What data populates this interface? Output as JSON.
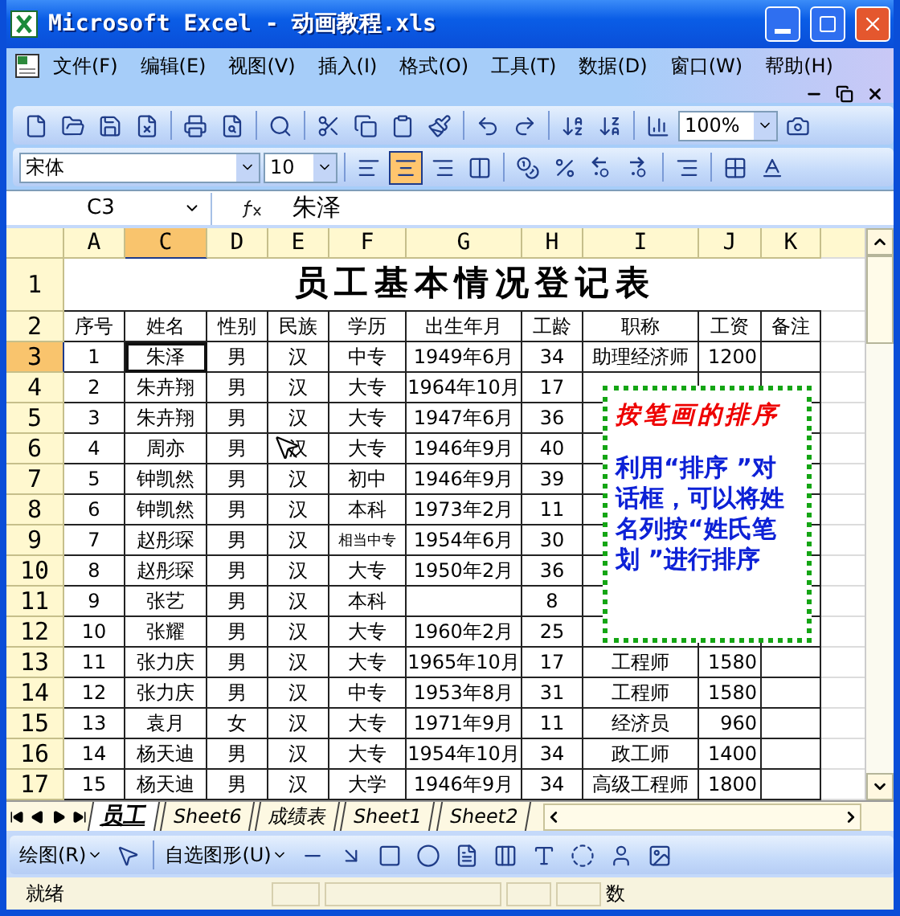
{
  "window": {
    "title": "Microsoft Excel - 动画教程.xls"
  },
  "menu": [
    {
      "label": "文件(F)"
    },
    {
      "label": "编辑(E)"
    },
    {
      "label": "视图(V)"
    },
    {
      "label": "插入(I)"
    },
    {
      "label": "格式(O)"
    },
    {
      "label": "工具(T)"
    },
    {
      "label": "数据(D)"
    },
    {
      "label": "窗口(W)"
    },
    {
      "label": "帮助(H)"
    }
  ],
  "standard_toolbar": {
    "zoom": "100%"
  },
  "formatting_toolbar": {
    "font": "宋体",
    "size": "10",
    "align": [
      {
        "selected": false
      },
      {
        "selected": true
      },
      {
        "selected": false
      }
    ]
  },
  "formula_bar": {
    "name_box": "C3",
    "value": "朱泽"
  },
  "sheet": {
    "columns": [
      {
        "label": "A",
        "selected": false
      },
      {
        "label": "C",
        "selected": true
      },
      {
        "label": "D",
        "selected": false
      },
      {
        "label": "E",
        "selected": false
      },
      {
        "label": "F",
        "selected": false
      },
      {
        "label": "G",
        "selected": false
      },
      {
        "label": "H",
        "selected": false
      },
      {
        "label": "I",
        "selected": false
      },
      {
        "label": "J",
        "selected": false
      },
      {
        "label": "K",
        "selected": false
      }
    ],
    "title_row": {
      "number": "1",
      "title": "员工基本情况登记表"
    },
    "header_row": {
      "number": "2",
      "cells": {
        "A": "序号",
        "C": "姓名",
        "D": "性别",
        "E": "民族",
        "F": "学历",
        "G": "出生年月",
        "H": "工龄",
        "I": "职称",
        "J": "工资",
        "K": "备注"
      }
    },
    "rows": [
      {
        "number": "3",
        "selected": true,
        "cells": {
          "A": "1",
          "C": "朱泽",
          "D": "男",
          "E": "汉",
          "F": "中专",
          "G": "1949年6月",
          "H": "34",
          "I": "助理经济师",
          "J": "1200"
        }
      },
      {
        "number": "4",
        "selected": false,
        "cells": {
          "A": "2",
          "C": "朱卉翔",
          "D": "男",
          "E": "汉",
          "F": "大专",
          "G": "1964年10月",
          "H": "17"
        }
      },
      {
        "number": "5",
        "selected": false,
        "cells": {
          "A": "3",
          "C": "朱卉翔",
          "D": "男",
          "E": "汉",
          "F": "大专",
          "G": "1947年6月",
          "H": "36"
        }
      },
      {
        "number": "6",
        "selected": false,
        "cells": {
          "A": "4",
          "C": "周亦",
          "D": "男",
          "E": "汉",
          "F": "大专",
          "G": "1946年9月",
          "H": "40"
        }
      },
      {
        "number": "7",
        "selected": false,
        "cells": {
          "A": "5",
          "C": "钟凯然",
          "D": "男",
          "E": "汉",
          "F": "初中",
          "G": "1946年9月",
          "H": "39"
        }
      },
      {
        "number": "8",
        "selected": false,
        "cells": {
          "A": "6",
          "C": "钟凯然",
          "D": "男",
          "E": "汉",
          "F": "本科",
          "G": "1973年2月",
          "H": "11"
        }
      },
      {
        "number": "9",
        "selected": false,
        "cells": {
          "A": "7",
          "C": "赵彤琛",
          "D": "男",
          "E": "汉",
          "F": "相当中专",
          "G": "1954年6月",
          "H": "30"
        }
      },
      {
        "number": "10",
        "selected": false,
        "cells": {
          "A": "8",
          "C": "赵彤琛",
          "D": "男",
          "E": "汉",
          "F": "大专",
          "G": "1950年2月",
          "H": "36"
        }
      },
      {
        "number": "11",
        "selected": false,
        "cells": {
          "A": "9",
          "C": "张艺",
          "D": "男",
          "E": "汉",
          "F": "本科",
          "H": "8"
        }
      },
      {
        "number": "12",
        "selected": false,
        "cells": {
          "A": "10",
          "C": "张耀",
          "D": "男",
          "E": "汉",
          "F": "大专",
          "G": "1960年2月",
          "H": "25"
        }
      },
      {
        "number": "13",
        "selected": false,
        "cells": {
          "A": "11",
          "C": "张力庆",
          "D": "男",
          "E": "汉",
          "F": "大专",
          "G": "1965年10月",
          "H": "17",
          "I": "工程师",
          "J": "1580"
        }
      },
      {
        "number": "14",
        "selected": false,
        "cells": {
          "A": "12",
          "C": "张力庆",
          "D": "男",
          "E": "汉",
          "F": "中专",
          "G": "1953年8月",
          "H": "31",
          "I": "工程师",
          "J": "1580"
        }
      },
      {
        "number": "15",
        "selected": false,
        "cells": {
          "A": "13",
          "C": "袁月",
          "D": "女",
          "E": "汉",
          "F": "大专",
          "G": "1971年9月",
          "H": "11",
          "I": "经济员",
          "J": "960"
        }
      },
      {
        "number": "16",
        "selected": false,
        "cells": {
          "A": "14",
          "C": "杨天迪",
          "D": "男",
          "E": "汉",
          "F": "大专",
          "G": "1954年10月",
          "H": "34",
          "I": "政工师",
          "J": "1400"
        }
      },
      {
        "number": "17",
        "selected": false,
        "cells": {
          "A": "15",
          "C": "杨天迪",
          "D": "男",
          "E": "汉",
          "F": "大学",
          "G": "1946年9月",
          "H": "34",
          "I": "高级工程师",
          "J": "1800"
        }
      }
    ]
  },
  "callout": {
    "title": "按笔画的排序",
    "body": "利用“排序 ”对话框，可以将姓名列按“姓氏笔划 ”进行排序"
  },
  "sheet_tabs": [
    {
      "label": "员工",
      "selected": true
    },
    {
      "label": "Sheet6",
      "selected": false
    },
    {
      "label": "成绩表",
      "selected": false
    },
    {
      "label": "Sheet1",
      "selected": false
    },
    {
      "label": "Sheet2",
      "selected": false
    }
  ],
  "drawing_toolbar": {
    "draw": "绘图(R)",
    "autoshapes": "自选图形(U)"
  },
  "status_bar": {
    "ready": "就绪",
    "mode": "数"
  }
}
